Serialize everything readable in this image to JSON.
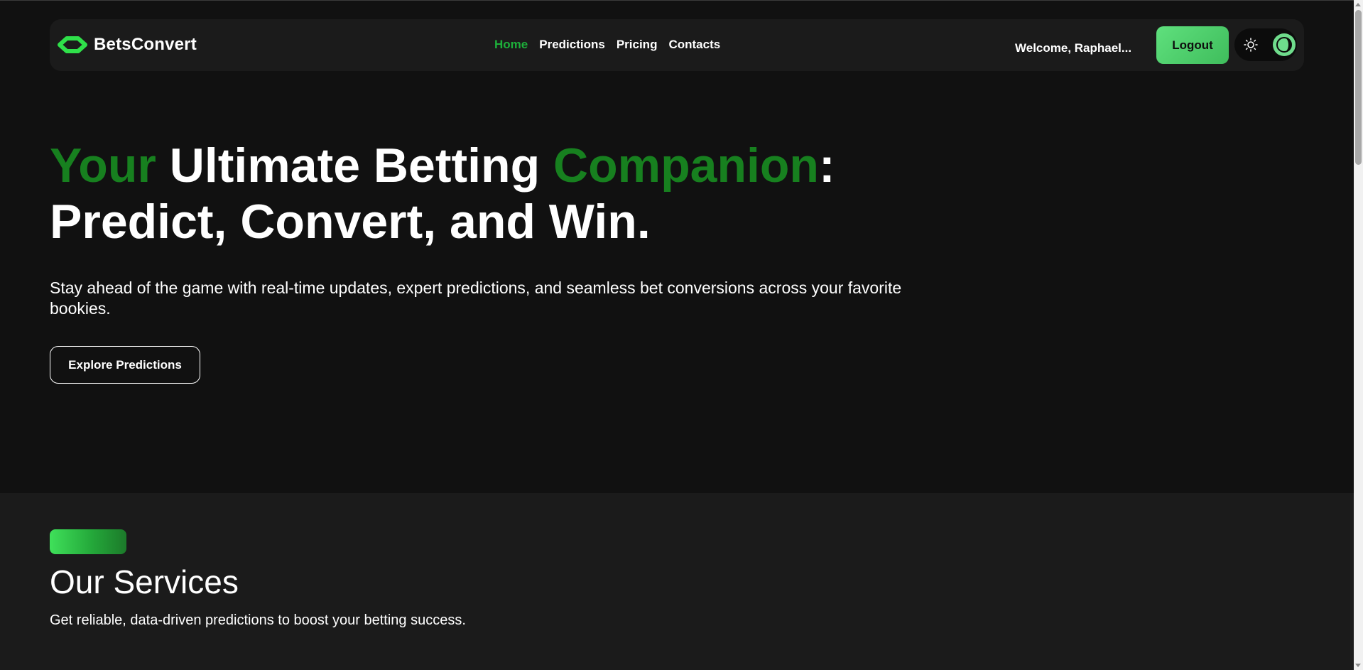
{
  "navbar": {
    "brand_name": "BetsConvert",
    "brand_icon": "betsconvert-logo-icon",
    "links": [
      {
        "label": "Home",
        "active": true
      },
      {
        "label": "Predictions",
        "active": false
      },
      {
        "label": "Pricing",
        "active": false
      },
      {
        "label": "Contacts",
        "active": false
      }
    ],
    "welcome_text": "Welcome, Raphael...",
    "logout_label": "Logout",
    "theme_toggle": {
      "light_icon": "sun-icon",
      "dark_icon": "moon-icon",
      "mode": "dark"
    }
  },
  "hero": {
    "title_word_1": "Your",
    "title_word_2": " Ultimate Betting ",
    "title_word_3": "Companion",
    "title_word_4": ":",
    "title_line_2": "Predict, Convert, and Win.",
    "subtitle": "Stay ahead of the game with real-time updates, expert predictions, and seamless bet conversions across your favorite bookies.",
    "cta_label": "Explore Predictions"
  },
  "services": {
    "title": "Our Services",
    "subtitle": "Get reliable, data-driven predictions to boost your betting success."
  },
  "colors": {
    "background": "#111111",
    "surface": "#1b1b1b",
    "accent": "#1db03a",
    "accent_dark": "#17801f",
    "button_gradient_start": "#5fe07d",
    "button_gradient_end": "#3fbd5c"
  }
}
